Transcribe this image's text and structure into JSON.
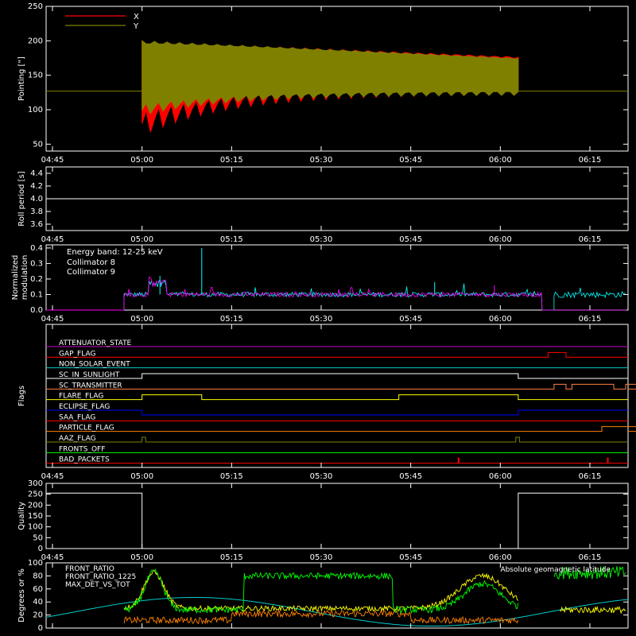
{
  "time_ticks": [
    "04:45",
    "05:00",
    "05:15",
    "05:30",
    "05:45",
    "06:00",
    "06:15"
  ],
  "chart_data": [
    {
      "type": "area",
      "ylabel": "Pointing [\"]",
      "ylim": [
        40,
        250
      ],
      "yticks": [
        50,
        100,
        150,
        200,
        250
      ],
      "series": [
        {
          "name": "X",
          "color": "#ff0000",
          "envelope_start": [
            80,
            200
          ],
          "envelope_end": [
            130,
            178
          ]
        },
        {
          "name": "Y",
          "color": "#808000",
          "envelope_start": [
            100,
            200
          ],
          "envelope_end": [
            125,
            175
          ]
        }
      ],
      "baseline": 127,
      "data_window": [
        "05:00",
        "06:03"
      ]
    },
    {
      "type": "line",
      "ylabel": "Roll period [s]",
      "ylim": [
        3.5,
        4.5
      ],
      "yticks": [
        3.6,
        3.8,
        4.0,
        4.2,
        4.4
      ],
      "value": 4.0
    },
    {
      "type": "line",
      "ylabel": "Normalized modulation",
      "ylim": [
        0,
        0.42
      ],
      "yticks": [
        0.0,
        0.1,
        0.2,
        0.3,
        0.4
      ],
      "annotation": "Energy band: 12-25 keV",
      "series": [
        {
          "name": "Collimator 8",
          "color": "#00ffff",
          "base": 0.1
        },
        {
          "name": "Collimator 9",
          "color": "#ff00ff",
          "base": 0.1
        }
      ]
    },
    {
      "type": "line",
      "ylabel": "Flags",
      "flags": [
        {
          "name": "ATTENUATOR_STATE",
          "color": "#cc00cc"
        },
        {
          "name": "GAP_FLAG",
          "color": "#ff0000"
        },
        {
          "name": "NON_SOLAR_EVENT",
          "color": "#00cccc"
        },
        {
          "name": "SC_IN_SUNLIGHT",
          "color": "#ffffff"
        },
        {
          "name": "SC_TRANSMITTER",
          "color": "#ff8040"
        },
        {
          "name": "FLARE_FLAG",
          "color": "#ffff00"
        },
        {
          "name": "ECLIPSE_FLAG",
          "color": "#0000ff"
        },
        {
          "name": "SAA_FLAG",
          "color": "#ff0000"
        },
        {
          "name": "PARTICLE_FLAG",
          "color": "#ff8000"
        },
        {
          "name": "AAZ_FLAG",
          "color": "#808000"
        },
        {
          "name": "FRONTS_OFF",
          "color": "#00ff00"
        },
        {
          "name": "BAD_PACKETS",
          "color": "#ff0000"
        }
      ]
    },
    {
      "type": "line",
      "ylabel": "Quality",
      "ylim": [
        0,
        300
      ],
      "yticks": [
        0,
        50,
        100,
        150,
        200,
        250,
        300
      ],
      "value": 255
    },
    {
      "type": "line",
      "ylabel": "Degrees or %",
      "ylim": [
        0,
        100
      ],
      "yticks": [
        0,
        20,
        40,
        60,
        80,
        100
      ],
      "series": [
        {
          "name": "FRONT_RATIO",
          "color": "#ffff00"
        },
        {
          "name": "FRONT_RATIO_1225",
          "color": "#00ff00"
        },
        {
          "name": "MAX_DET_VS_TOT",
          "color": "#ff8000"
        }
      ],
      "annotation": "Absolute geomagnetic latitude",
      "annotation_color": "#00cccc"
    }
  ]
}
